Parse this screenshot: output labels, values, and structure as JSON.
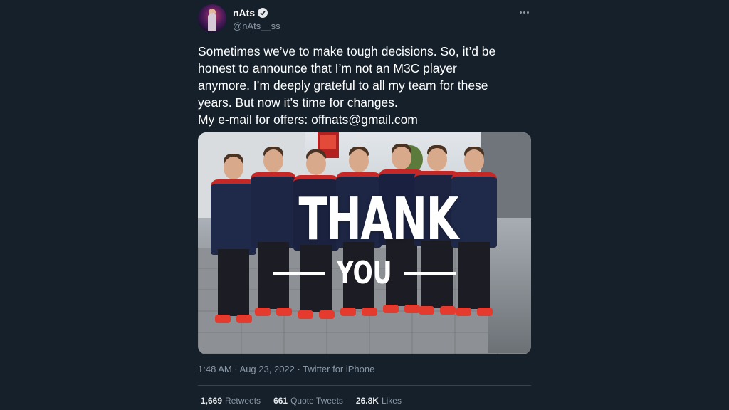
{
  "tweet": {
    "author": {
      "display_name": "nAts",
      "handle": "@nAts__ss",
      "verified": true,
      "avatar": "avatar-photo"
    },
    "more_icon": "more-dots-icon",
    "text_lines": [
      "Sometimes we’ve to make tough decisions. So, it’d be",
      "honest to announce that I’m not an M3C player",
      "anymore. I’m deeply grateful to all my team for these",
      "years. But now it’s time for changes.",
      "My e-mail for offers: offnats@gmail.com"
    ],
    "image": {
      "overlay_title": "THANK",
      "overlay_subtitle": "YOU",
      "description": "team photo"
    },
    "meta": "1:48 AM · Aug 23, 2022 · Twitter for iPhone",
    "stats": [
      {
        "value": "1,669",
        "label": "Retweets"
      },
      {
        "value": "661",
        "label": "Quote Tweets"
      },
      {
        "value": "26.8K",
        "label": "Likes"
      }
    ]
  },
  "colors": {
    "background": "#15202b",
    "text": "#ffffff",
    "secondary_text": "#8b98a5",
    "divider": "#38444d",
    "accent_red": "#e53a2e"
  }
}
